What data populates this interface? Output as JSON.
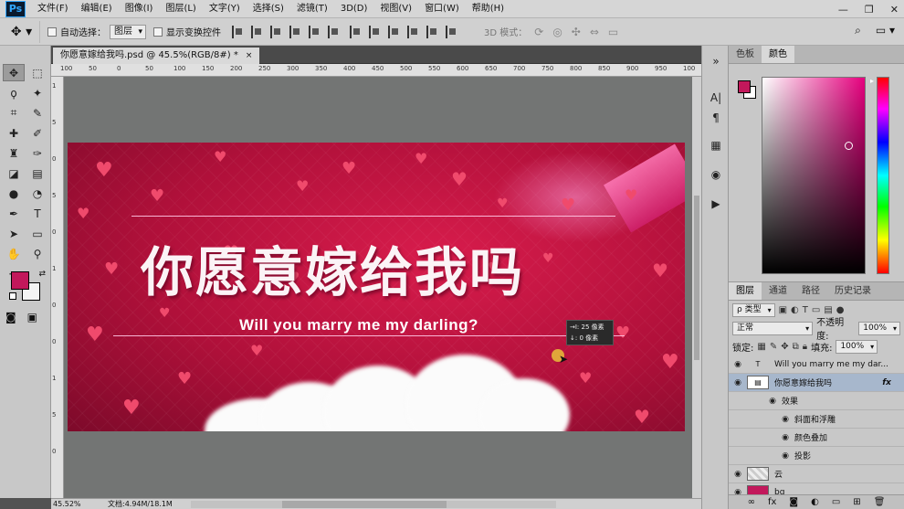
{
  "app": {
    "logo": "Ps"
  },
  "menu": [
    "文件(F)",
    "编辑(E)",
    "图像(I)",
    "图层(L)",
    "文字(Y)",
    "选择(S)",
    "滤镜(T)",
    "3D(D)",
    "视图(V)",
    "窗口(W)",
    "帮助(H)"
  ],
  "window": {
    "minimize": "—",
    "restore": "❐",
    "close": "✕"
  },
  "options": {
    "auto_select_label": "自动选择：",
    "auto_select_value": "图层",
    "transform_label": "显示变换控件",
    "mode3d_label": "3D 模式："
  },
  "document": {
    "tab_title": "你愿意嫁给我吗.psd @ 45.5%(RGB/8#) *",
    "close": "×"
  },
  "rulers": {
    "h": [
      "100",
      "50",
      "0",
      "50",
      "100",
      "150",
      "200",
      "250",
      "300",
      "350",
      "400",
      "450",
      "500",
      "550",
      "600",
      "650",
      "700",
      "750",
      "800",
      "850",
      "900",
      "950",
      "100"
    ],
    "v": [
      "1",
      "5",
      "0",
      "5",
      "0",
      "1",
      "0",
      "0",
      "1",
      "5",
      "0"
    ]
  },
  "artwork": {
    "title_cn": "你愿意嫁给我吗",
    "subtitle_en": "Will you marry me my darling?",
    "tooltip_line1": "→I: 25 像素",
    "tooltip_line2": "↓: 0 像素"
  },
  "status": {
    "zoom": "45.52%",
    "doc_size": "文档:4.94M/18.1M"
  },
  "color_panel": {
    "tabs": [
      "色板",
      "颜色"
    ],
    "active_tab": "颜色",
    "fg_color": "#c2185b",
    "bg_color": "#ffffff"
  },
  "layers_panel": {
    "tabs": [
      "图层",
      "通道",
      "路径",
      "历史记录"
    ],
    "filter": "ρ 类型",
    "blend_mode": "正常",
    "opacity_label": "不透明度:",
    "opacity_value": "100%",
    "lock_label": "锁定:",
    "fill_label": "填充:",
    "fill_value": "100%",
    "layers": [
      {
        "name": "Will you marry me my dar...",
        "type": "text"
      },
      {
        "name": "你愿意嫁给我吗",
        "type": "smart",
        "fx": "fx"
      },
      {
        "name": "效果",
        "type": "effects"
      },
      {
        "name": "斜面和浮雕",
        "type": "effect"
      },
      {
        "name": "颜色叠加",
        "type": "effect"
      },
      {
        "name": "投影",
        "type": "effect"
      },
      {
        "name": "云",
        "type": "smart"
      },
      {
        "name": "bg",
        "type": "smart"
      }
    ]
  },
  "tools_fg_color": "#c2185b",
  "tools_bg_color": "#f4f4f4"
}
